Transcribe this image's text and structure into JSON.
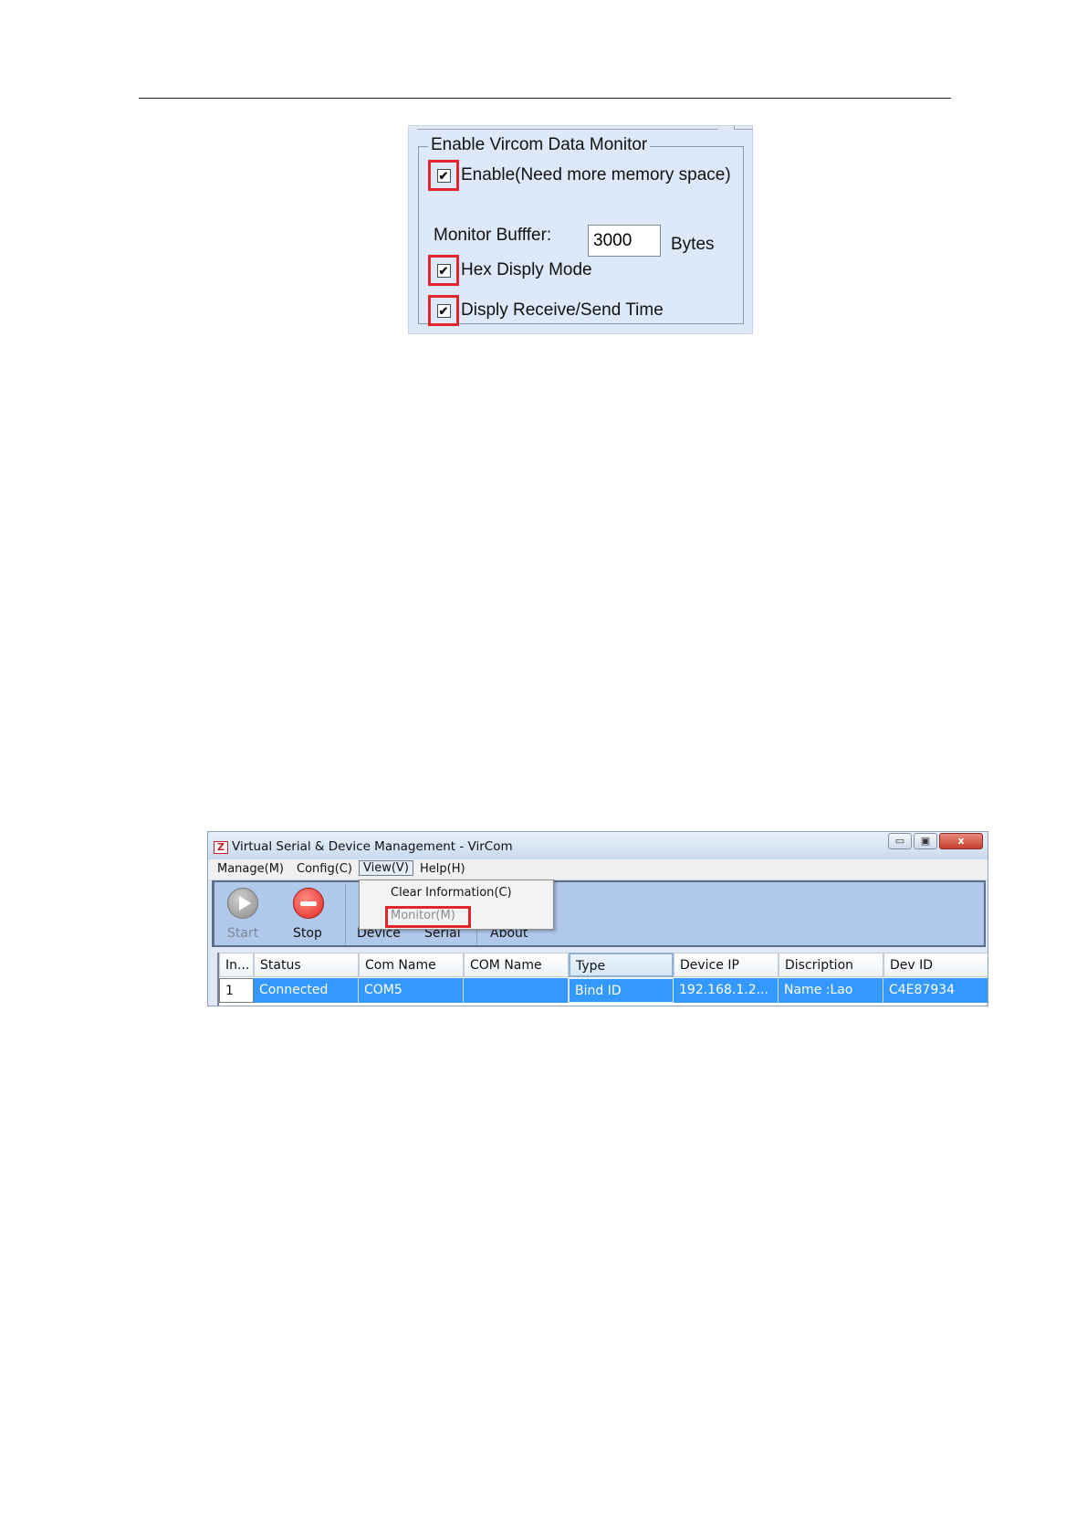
{
  "monitor_panel": {
    "group_title": "Enable Vircom Data Monitor",
    "options": [
      {
        "label": "Enable(Need more memory space)",
        "checked": true
      },
      {
        "label": "Hex Disply Mode",
        "checked": true
      },
      {
        "label": "Disply Receive/Send Time",
        "checked": true
      }
    ],
    "buffer_label": "Monitor Bufffer:",
    "buffer_value": "3000",
    "buffer_unit": "Bytes",
    "check_glyph": "✔"
  },
  "vircom": {
    "title": "Virtual Serial & Device Management - VirCom",
    "logo": "Z",
    "window_buttons": {
      "minimize": "▭",
      "maximize": "▣",
      "close": "x"
    },
    "menu": [
      "Manage(M)",
      "Config(C)",
      "View(V)",
      "Help(H)"
    ],
    "dropdown": [
      "Clear Information(C)",
      "Monitor(M)"
    ],
    "toolbar": [
      "Start",
      "Stop",
      "Device",
      "Serial",
      "About"
    ],
    "table": {
      "headers": [
        "In...",
        "Status",
        "Com Name",
        "COM Name",
        "Type",
        "Device IP",
        "Discription",
        "Dev ID"
      ],
      "rows": [
        [
          "1",
          "Connected",
          "COM5",
          "",
          "Bind ID",
          "192.168.1.2...",
          "Name :Lao",
          "C4E87934"
        ]
      ]
    },
    "colors": {
      "accent": "#3399ff",
      "highlight": "#e0262c",
      "toolbar": "#b0c8ea"
    }
  }
}
